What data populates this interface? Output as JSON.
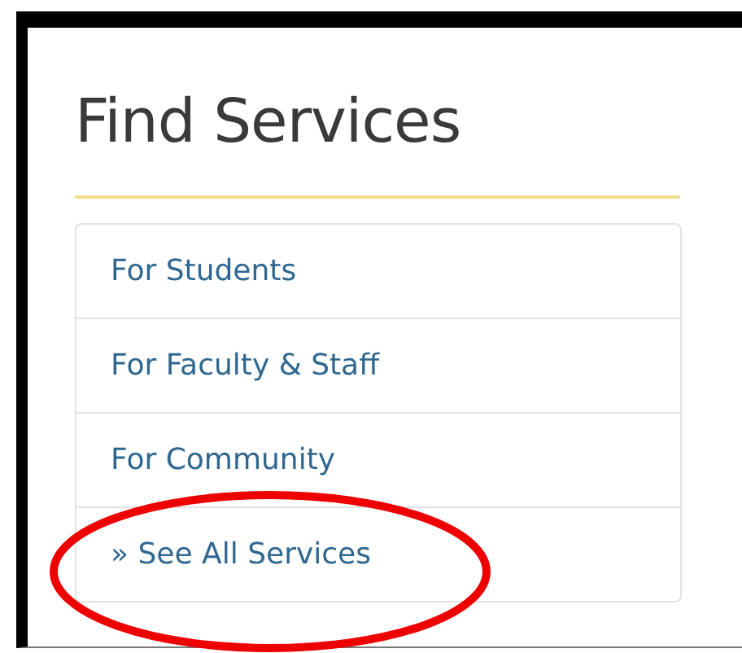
{
  "heading": "Find Services",
  "links": [
    {
      "label": "For Students",
      "circled": false
    },
    {
      "label": "For Faculty & Staff",
      "circled": false
    },
    {
      "label": "For Community",
      "circled": false
    },
    {
      "label": "» See All Services",
      "circled": true
    }
  ]
}
